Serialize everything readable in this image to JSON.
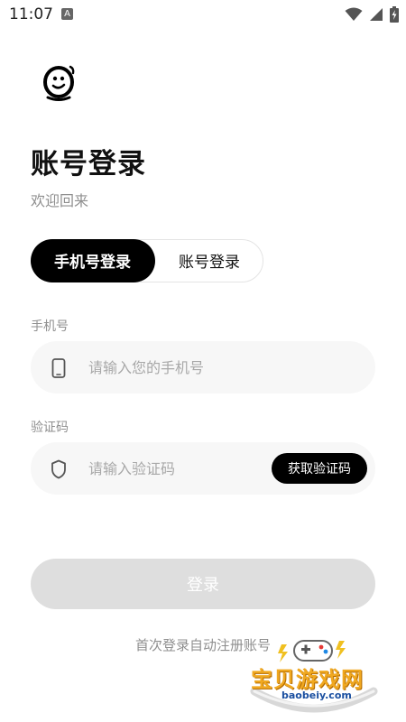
{
  "status_bar": {
    "time": "11:07",
    "notification_letter": "A"
  },
  "login": {
    "title": "账号登录",
    "subtitle": "欢迎回来",
    "tabs": [
      {
        "label": "手机号登录",
        "active": true
      },
      {
        "label": "账号登录",
        "active": false
      }
    ],
    "phone_label": "手机号",
    "phone_placeholder": "请输入您的手机号",
    "code_label": "验证码",
    "code_placeholder": "请输入验证码",
    "get_code_label": "获取验证码",
    "submit_label": "登录",
    "hint": "首次登录自动注册账号"
  },
  "watermark": {
    "title": "宝贝游戏网",
    "url": "baobeiy.com"
  },
  "colors": {
    "accent": "#000000",
    "disabled_button": "#dedede",
    "muted_text": "#8f8f8f",
    "field_bg": "#f7f7f7"
  }
}
